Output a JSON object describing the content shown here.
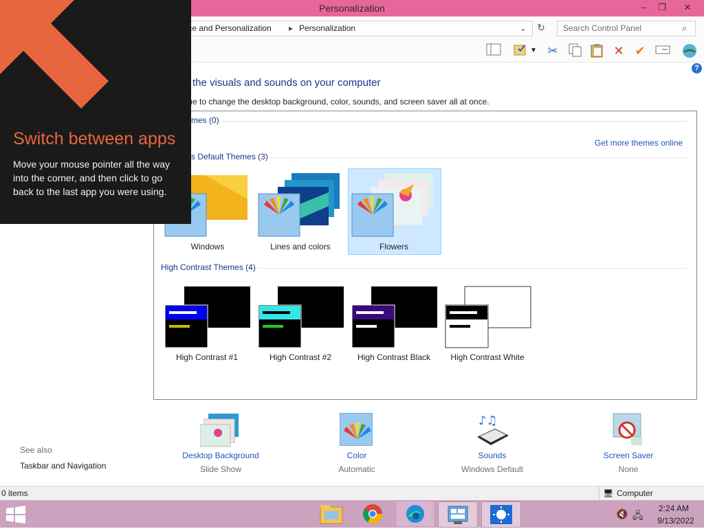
{
  "window": {
    "title": "Personalization",
    "minimize": "–",
    "restore": "❐",
    "close": "✕"
  },
  "address": {
    "crumb1": "rance and Personalization",
    "crumb2": "Personalization",
    "search_placeholder": "Search Control Panel"
  },
  "toolbar": {
    "icons": [
      "view-icon",
      "properties-icon",
      "cut-icon",
      "copy-icon",
      "paste-icon",
      "delete-icon",
      "check-icon",
      "rename-icon",
      "globe-icon"
    ]
  },
  "main": {
    "heading": "the visuals and sounds on your computer",
    "subtext": "me to change the desktop background, color, sounds, and screen saver all at once.",
    "my_themes": "mes (0)",
    "get_more": "Get more themes online",
    "default_group": "s Default Themes (3)",
    "default_themes": [
      "Windows",
      "Lines and colors",
      "Flowers"
    ],
    "hc_group": "High Contrast Themes (4)",
    "hc_themes": [
      "High Contrast #1",
      "High Contrast #2",
      "High Contrast Black",
      "High Contrast White"
    ]
  },
  "bottom": {
    "items": [
      {
        "label": "Desktop Background",
        "sub": "Slide Show"
      },
      {
        "label": "Color",
        "sub": "Automatic"
      },
      {
        "label": "Sounds",
        "sub": "Windows Default"
      },
      {
        "label": "Screen Saver",
        "sub": "None"
      }
    ]
  },
  "see_also": {
    "title": "See also",
    "link": "Taskbar and Navigation"
  },
  "status": {
    "items": "0 items",
    "computer": "Computer"
  },
  "tip": {
    "title": "Switch between apps",
    "text": "Move your mouse pointer all the way into the corner, and then click to go back to the last app you were using."
  },
  "clock": {
    "time": "2:24 AM",
    "date": "9/13/2022"
  },
  "colors": {
    "titlebar": "#e7679a",
    "taskbar": "#cba3bf",
    "link": "#1e55b4",
    "tip_accent": "#e8663e"
  }
}
